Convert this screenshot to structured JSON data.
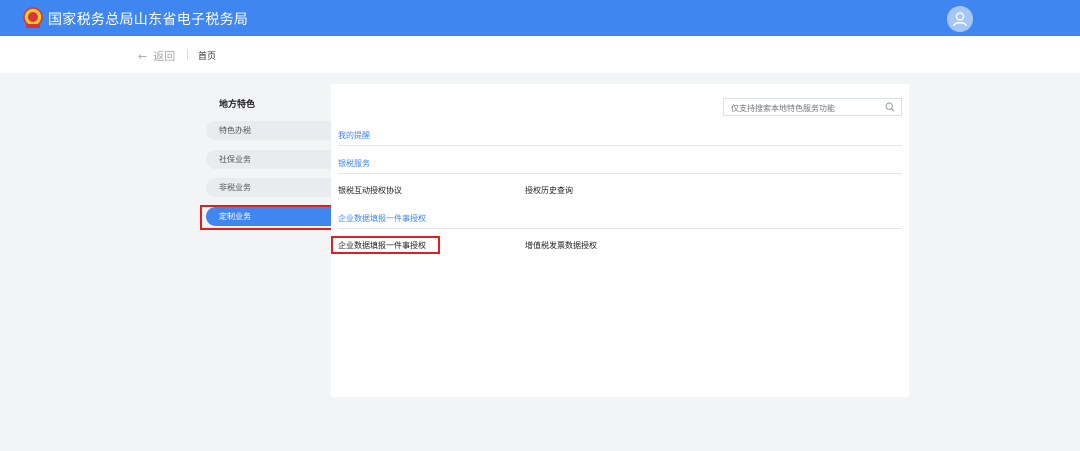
{
  "header": {
    "title": "国家税务总局山东省电子税务局",
    "logo_icon": "tax-emblem-icon",
    "avatar_icon": "user-avatar-icon"
  },
  "subnav": {
    "back_label": "返回",
    "back_arrow": "←",
    "breadcrumb": "首页"
  },
  "sidebar": {
    "title": "地方特色",
    "items": [
      {
        "label": "特色办税"
      },
      {
        "label": "社保业务"
      },
      {
        "label": "非税业务"
      },
      {
        "label": "定制业务",
        "active": true
      }
    ]
  },
  "search": {
    "placeholder": "仅支持搜索本地特色服务功能"
  },
  "sections": [
    {
      "title": "我的提醒",
      "links": []
    },
    {
      "title": "银税服务",
      "links": [
        "银税互动授权协议",
        "授权历史查询"
      ]
    },
    {
      "title": "企业数据填报一件事授权",
      "links": [
        "企业数据填报一件事授权",
        "增值税发票数据授权"
      ]
    }
  ],
  "colors": {
    "primary": "#3f86f1",
    "highlight": "#e02020"
  }
}
